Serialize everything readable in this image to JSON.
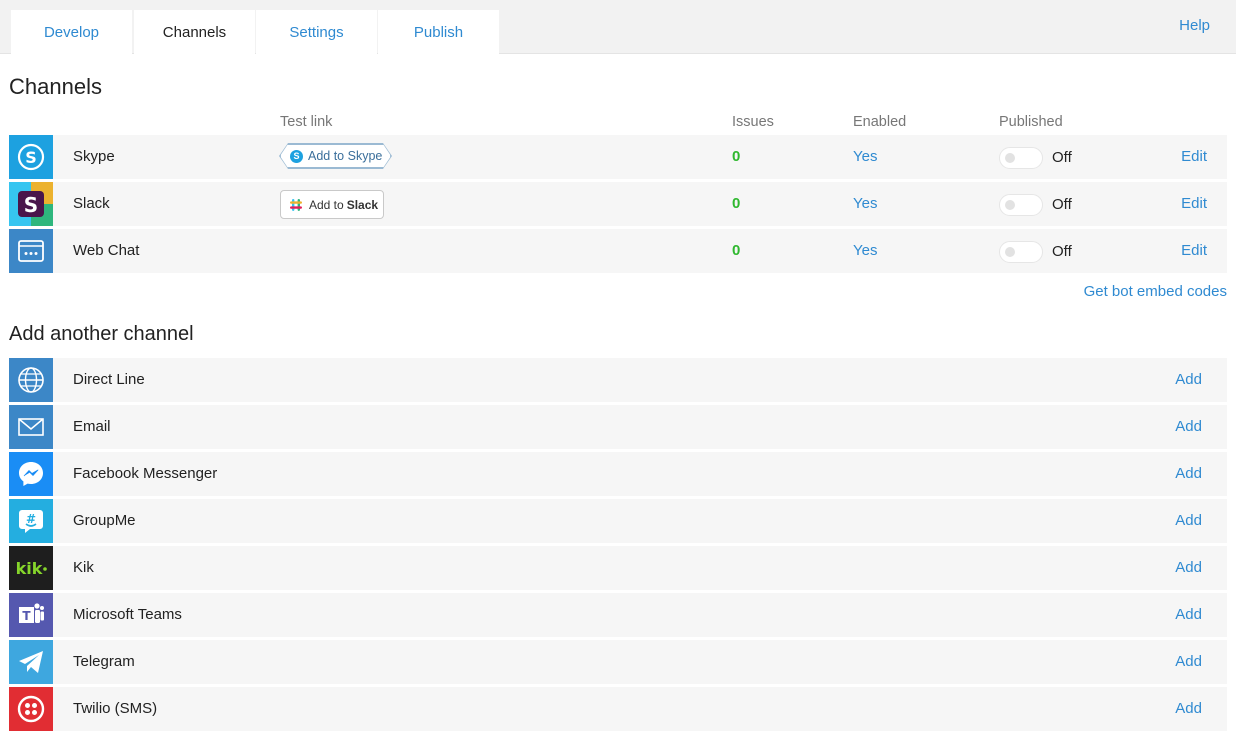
{
  "tabs": [
    {
      "label": "Develop",
      "active": false
    },
    {
      "label": "Channels",
      "active": true
    },
    {
      "label": "Settings",
      "active": false
    },
    {
      "label": "Publish",
      "active": false
    }
  ],
  "help_label": "Help",
  "channels": {
    "title": "Channels",
    "columns": {
      "test_link": "Test link",
      "issues": "Issues",
      "enabled": "Enabled",
      "published": "Published"
    },
    "rows": [
      {
        "name": "Skype",
        "test_button": "Add to Skype",
        "issues": "0",
        "enabled": "Yes",
        "published": "Off",
        "action": "Edit",
        "icon": "skype-icon",
        "color": "#1da1e0"
      },
      {
        "name": "Slack",
        "test_button_prefix": "Add to",
        "test_button_bold": "Slack",
        "issues": "0",
        "enabled": "Yes",
        "published": "Off",
        "action": "Edit",
        "icon": "slack-icon"
      },
      {
        "name": "Web Chat",
        "issues": "0",
        "enabled": "Yes",
        "published": "Off",
        "action": "Edit",
        "icon": "web-chat-icon",
        "color": "#3c87c7"
      }
    ],
    "embed_link": "Get bot embed codes"
  },
  "add_channel": {
    "title": "Add another channel",
    "rows": [
      {
        "name": "Direct Line",
        "action": "Add",
        "icon": "globe-icon",
        "color": "#3c87c7"
      },
      {
        "name": "Email",
        "action": "Add",
        "icon": "envelope-icon",
        "color": "#3c87c7"
      },
      {
        "name": "Facebook Messenger",
        "action": "Add",
        "icon": "messenger-icon",
        "color": "#1a8df5"
      },
      {
        "name": "GroupMe",
        "action": "Add",
        "icon": "groupme-icon",
        "color": "#24aee0"
      },
      {
        "name": "Kik",
        "action": "Add",
        "icon": "kik-icon",
        "color": "#1e1e1e"
      },
      {
        "name": "Microsoft Teams",
        "action": "Add",
        "icon": "teams-icon",
        "color": "#5558af"
      },
      {
        "name": "Telegram",
        "action": "Add",
        "icon": "telegram-icon",
        "color": "#3ea7df"
      },
      {
        "name": "Twilio (SMS)",
        "action": "Add",
        "icon": "twilio-icon",
        "color": "#e12d33"
      }
    ]
  }
}
